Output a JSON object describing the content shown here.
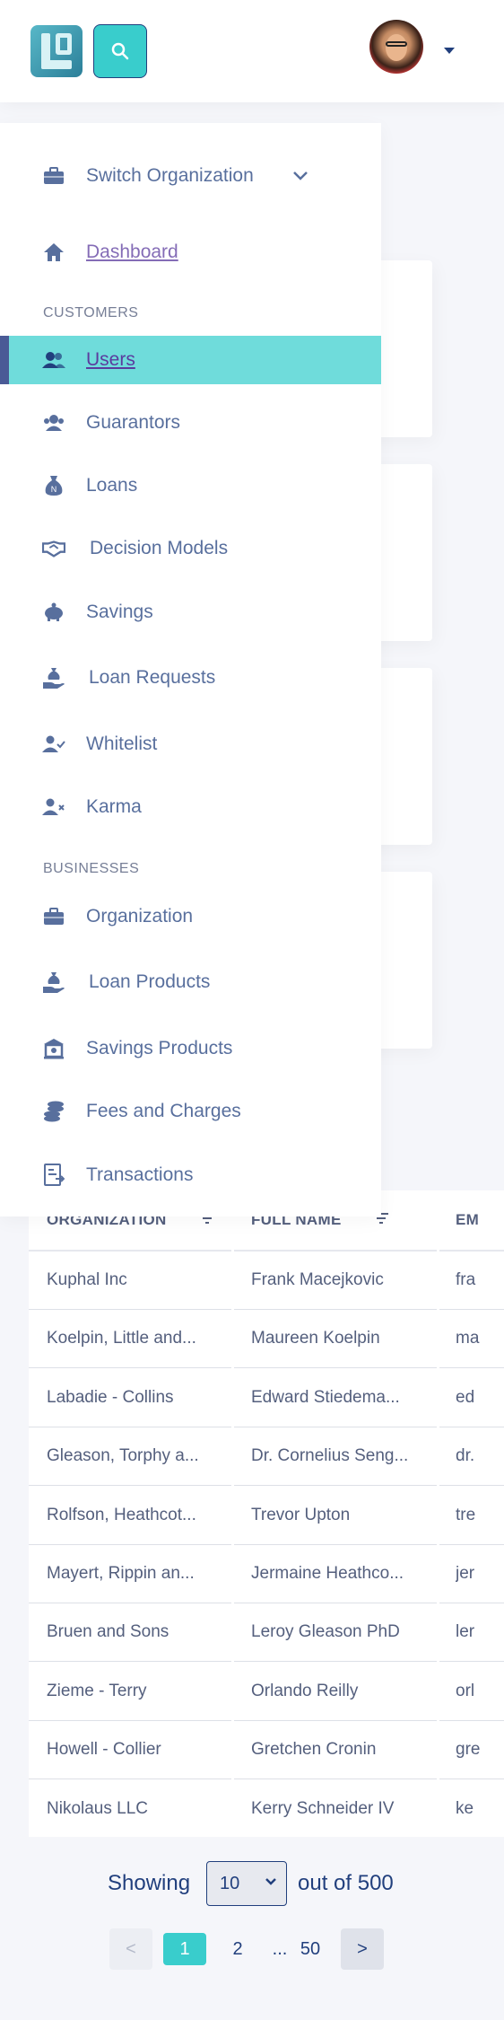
{
  "header": {
    "avatar_alt": "User avatar"
  },
  "sidebar": {
    "switch_org": "Switch Organization",
    "dashboard": "Dashboard",
    "sections": {
      "customers": "CUSTOMERS",
      "businesses": "BUSINESSES"
    },
    "customers": [
      {
        "label": "Users",
        "icon": "users-icon",
        "active": true
      },
      {
        "label": "Guarantors",
        "icon": "guarantors-icon"
      },
      {
        "label": "Loans",
        "icon": "money-sack-icon"
      },
      {
        "label": "Decision Models",
        "icon": "handshake-icon"
      },
      {
        "label": "Savings",
        "icon": "piggy-bank-icon"
      },
      {
        "label": "Loan Requests",
        "icon": "hand-money-icon"
      },
      {
        "label": "Whitelist",
        "icon": "user-check-icon"
      },
      {
        "label": "Karma",
        "icon": "user-x-icon"
      }
    ],
    "businesses": [
      {
        "label": "Organization",
        "icon": "briefcase-icon"
      },
      {
        "label": "Loan Products",
        "icon": "hand-money-icon"
      },
      {
        "label": "Savings Products",
        "icon": "bank-icon"
      },
      {
        "label": "Fees and Charges",
        "icon": "coins-icon"
      },
      {
        "label": "Transactions",
        "icon": "transactions-icon"
      }
    ]
  },
  "table": {
    "headers": [
      "ORGANIZATION",
      "FULL NAME",
      "EM"
    ],
    "rows": [
      [
        "Kuphal Inc",
        "Frank Macejkovic",
        "fra"
      ],
      [
        "Koelpin, Little and...",
        "Maureen Koelpin",
        "ma"
      ],
      [
        "Labadie - Collins",
        "Edward Stiedema...",
        "ed"
      ],
      [
        "Gleason, Torphy a...",
        "Dr. Cornelius Seng...",
        "dr."
      ],
      [
        "Rolfson, Heathcot...",
        "Trevor Upton",
        "tre"
      ],
      [
        "Mayert, Rippin an...",
        "Jermaine Heathco...",
        "jer"
      ],
      [
        "Bruen and Sons",
        "Leroy Gleason PhD",
        "ler"
      ],
      [
        "Zieme - Terry",
        "Orlando Reilly",
        "orl"
      ],
      [
        "Howell - Collier",
        "Gretchen Cronin",
        "gre"
      ],
      [
        "Nikolaus LLC",
        "Kerry Schneider IV",
        "ke"
      ]
    ]
  },
  "pagination": {
    "showing": "Showing",
    "per_page": "10",
    "out_of": "out of 500",
    "prev": "<",
    "next": ">",
    "pages": [
      "1",
      "2",
      "...",
      "50"
    ],
    "current_page": "1"
  },
  "colors": {
    "accent": "#39cdcc",
    "active_bg": "#6fdcdb",
    "primary": "#213f7d",
    "link": "#5b3c9e"
  }
}
